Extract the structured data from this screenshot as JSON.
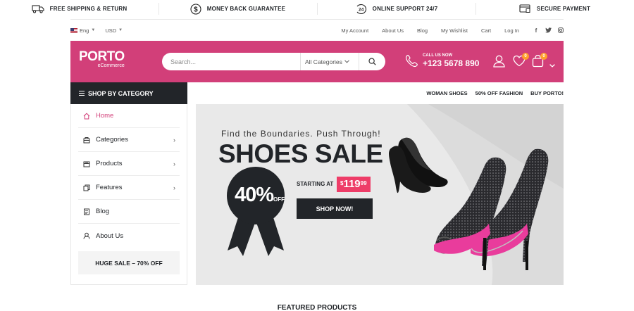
{
  "topbar": [
    {
      "icon": "truck-icon",
      "label": "FREE SHIPPING & RETURN"
    },
    {
      "icon": "dollar-icon",
      "label": "MONEY BACK GUARANTEE"
    },
    {
      "icon": "support-24-icon",
      "label": "ONLINE SUPPORT 24/7"
    },
    {
      "icon": "secure-payment-icon",
      "label": "SECURE PAYMENT"
    }
  ],
  "header_top": {
    "language": "Eng",
    "currency": "USD",
    "links": [
      "My Account",
      "About Us",
      "Blog",
      "My Wishlist",
      "Cart",
      "Log In"
    ],
    "social": [
      "f",
      "t",
      "ig"
    ]
  },
  "brand": {
    "name": "PORTO",
    "sub": "eCommerce",
    "color": "#d23f79"
  },
  "search": {
    "placeholder": "Search...",
    "category": "All Categories"
  },
  "call": {
    "label": "CALL US NOW",
    "number": "+123 5678 890"
  },
  "header_icons": {
    "wishlist_count": "0",
    "cart_count": "0"
  },
  "category_menu": {
    "title": "SHOP BY CATEGORY",
    "items": [
      {
        "label": "Home",
        "icon": "home-icon",
        "chevron": false,
        "active": true
      },
      {
        "label": "Categories",
        "icon": "categories-icon",
        "chevron": true
      },
      {
        "label": "Products",
        "icon": "products-icon",
        "chevron": true
      },
      {
        "label": "Features",
        "icon": "features-icon",
        "chevron": true
      },
      {
        "label": "Blog",
        "icon": "blog-icon",
        "chevron": false
      },
      {
        "label": "About Us",
        "icon": "about-icon",
        "chevron": false
      }
    ],
    "sale": "HUGE SALE – 70% OFF"
  },
  "nav_links": [
    "WOMAN SHOES",
    "50% OFF FASHION",
    "BUY PORTO!"
  ],
  "banner": {
    "tagline": "Find the Boundaries. Push Through!",
    "title": "SHOES SALE",
    "starting_label": "STARTING AT",
    "price_currency": "$",
    "price_amount": "119",
    "price_cents": "99",
    "cta": "SHOP NOW!",
    "discount": "40%",
    "discount_off": "OFF"
  },
  "featured_title": "FEATURED PRODUCTS"
}
